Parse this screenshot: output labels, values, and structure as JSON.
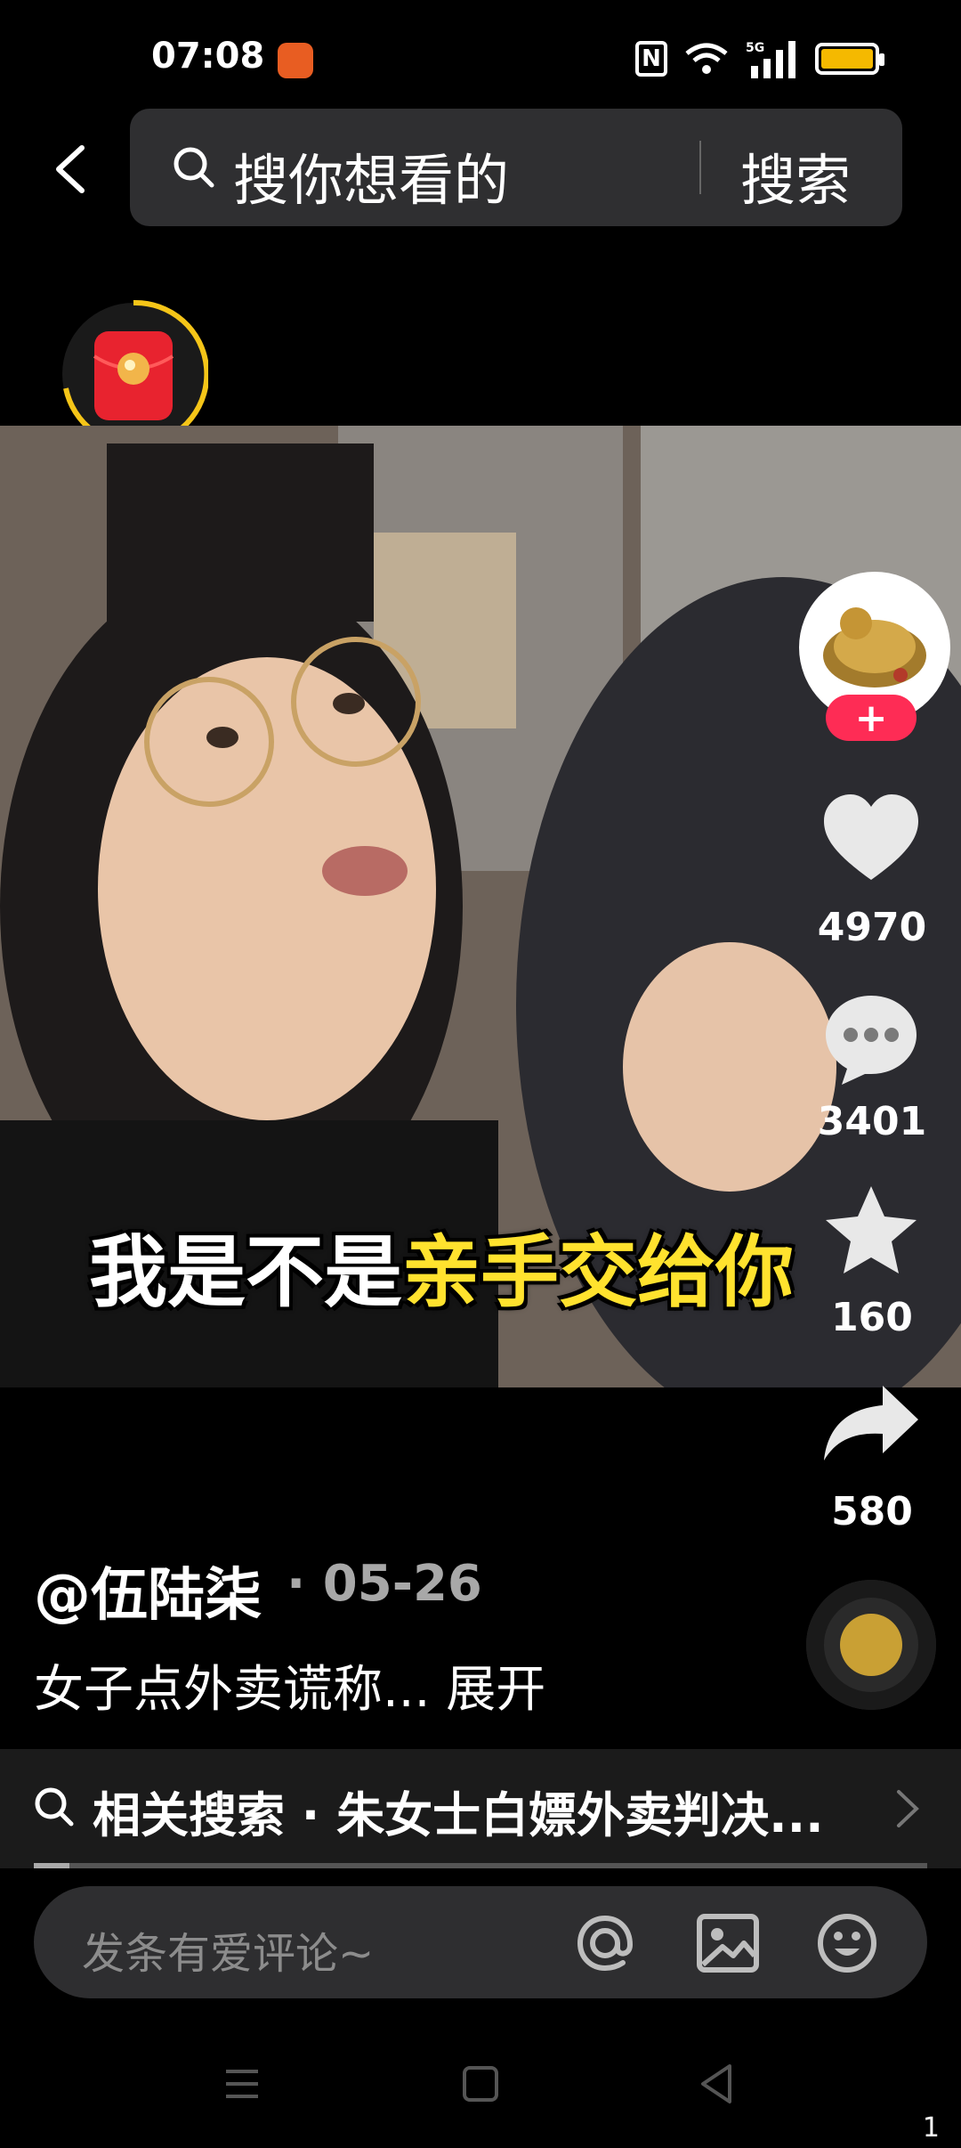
{
  "status_bar": {
    "time": "07:08",
    "network": "5G"
  },
  "search": {
    "placeholder": "搜你想看的",
    "button": "搜索"
  },
  "video": {
    "subtitle_white": "我是不是",
    "subtitle_yellow": "亲手交给你"
  },
  "actions": {
    "likes": "4970",
    "comments": "3401",
    "favorites": "160",
    "shares": "580",
    "follow_label": "+"
  },
  "post": {
    "author": "@伍陆柒",
    "date": "· 05-26",
    "caption": "女子点外卖谎称... 展开"
  },
  "related": {
    "text": "相关搜索 · 朱女士白嫖外卖判决..."
  },
  "comment_bar": {
    "placeholder": "发条有爱评论~"
  },
  "watch_progress": 0.04,
  "page_indicator": "1",
  "colors": {
    "accent_pink": "#fe2c55",
    "subtitle_yellow": "#ffe22e",
    "battery": "#f5b900"
  }
}
